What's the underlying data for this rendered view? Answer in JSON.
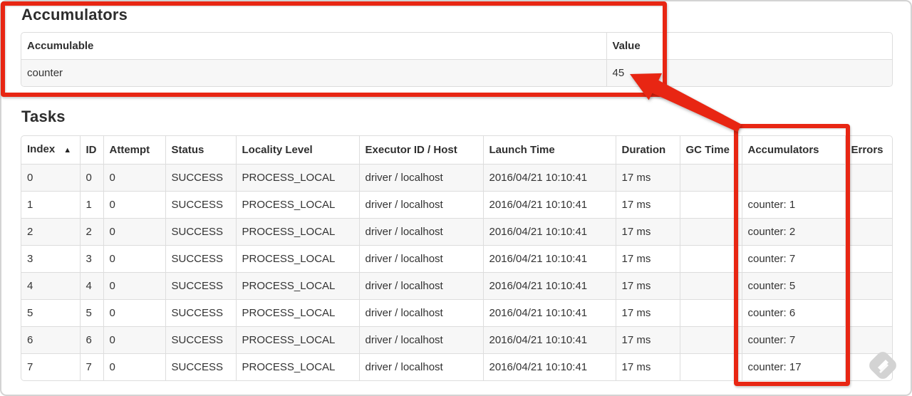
{
  "accumulators_section": {
    "heading": "Accumulators",
    "table": {
      "headers": [
        "Accumulable",
        "Value"
      ],
      "rows": [
        [
          "counter",
          "45"
        ]
      ]
    }
  },
  "tasks_section": {
    "heading": "Tasks",
    "table": {
      "headers": [
        "Index",
        "ID",
        "Attempt",
        "Status",
        "Locality Level",
        "Executor ID / Host",
        "Launch Time",
        "Duration",
        "GC Time",
        "Accumulators",
        "Errors"
      ],
      "sort_column": "Index",
      "sort_indicator": "▲",
      "rows": [
        [
          "0",
          "0",
          "0",
          "SUCCESS",
          "PROCESS_LOCAL",
          "driver / localhost",
          "2016/04/21 10:10:41",
          "17 ms",
          "",
          "",
          ""
        ],
        [
          "1",
          "1",
          "0",
          "SUCCESS",
          "PROCESS_LOCAL",
          "driver / localhost",
          "2016/04/21 10:10:41",
          "17 ms",
          "",
          "counter: 1",
          ""
        ],
        [
          "2",
          "2",
          "0",
          "SUCCESS",
          "PROCESS_LOCAL",
          "driver / localhost",
          "2016/04/21 10:10:41",
          "17 ms",
          "",
          "counter: 2",
          ""
        ],
        [
          "3",
          "3",
          "0",
          "SUCCESS",
          "PROCESS_LOCAL",
          "driver / localhost",
          "2016/04/21 10:10:41",
          "17 ms",
          "",
          "counter: 7",
          ""
        ],
        [
          "4",
          "4",
          "0",
          "SUCCESS",
          "PROCESS_LOCAL",
          "driver / localhost",
          "2016/04/21 10:10:41",
          "17 ms",
          "",
          "counter: 5",
          ""
        ],
        [
          "5",
          "5",
          "0",
          "SUCCESS",
          "PROCESS_LOCAL",
          "driver / localhost",
          "2016/04/21 10:10:41",
          "17 ms",
          "",
          "counter: 6",
          ""
        ],
        [
          "6",
          "6",
          "0",
          "SUCCESS",
          "PROCESS_LOCAL",
          "driver / localhost",
          "2016/04/21 10:10:41",
          "17 ms",
          "",
          "counter: 7",
          ""
        ],
        [
          "7",
          "7",
          "0",
          "SUCCESS",
          "PROCESS_LOCAL",
          "driver / localhost",
          "2016/04/21 10:10:41",
          "17 ms",
          "",
          "counter: 17",
          ""
        ]
      ]
    }
  },
  "annotations": {
    "color": "#e82613",
    "highlighted_value": "45",
    "highlighted_column": "Accumulators"
  },
  "watermark": {
    "icon": "skitch-watermark",
    "color": "#d3d3d3"
  }
}
